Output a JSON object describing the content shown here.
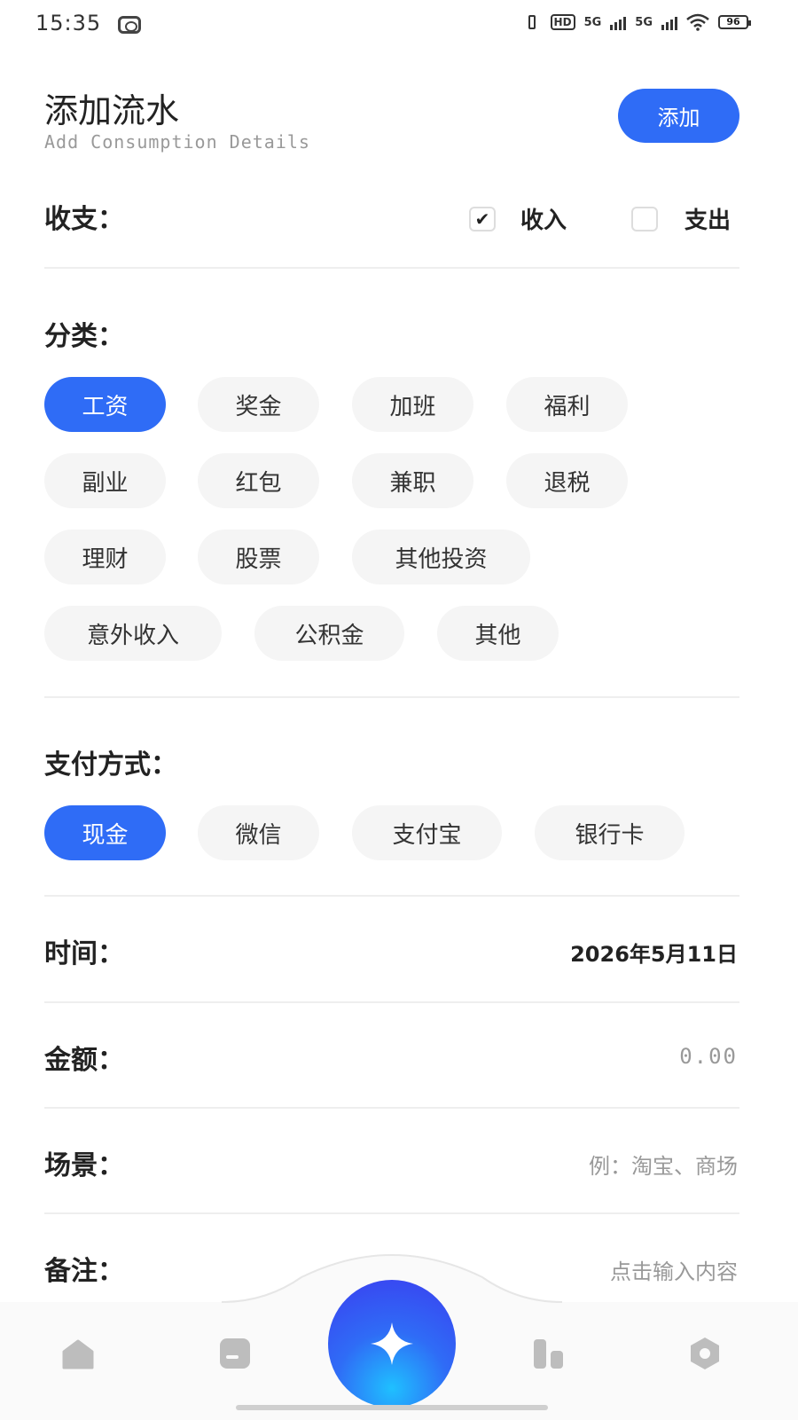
{
  "status_bar": {
    "time": "15:35",
    "battery": "96",
    "net1": "5G",
    "net2": "5G",
    "hd": "HD"
  },
  "header": {
    "title": "添加流水",
    "subtitle": "Add Consumption Details",
    "add_button": "添加"
  },
  "type_section": {
    "label": "收支：",
    "options": [
      {
        "label": "收入",
        "checked": true
      },
      {
        "label": "支出",
        "checked": false
      }
    ]
  },
  "category_section": {
    "label": "分类：",
    "items": [
      "工资",
      "奖金",
      "加班",
      "福利",
      "副业",
      "红包",
      "兼职",
      "退税",
      "理财",
      "股票",
      "其他投资",
      "意外收入",
      "公积金",
      "其他"
    ],
    "selected": "工资"
  },
  "payment_section": {
    "label": "支付方式：",
    "items": [
      "现金",
      "微信",
      "支付宝",
      "银行卡"
    ],
    "selected": "现金"
  },
  "time_row": {
    "label": "时间：",
    "value": "2026年5月11日"
  },
  "amount_row": {
    "label": "金额：",
    "placeholder": "0.00"
  },
  "scene_row": {
    "label": "场景：",
    "placeholder": "例：淘宝、商场"
  },
  "note_row": {
    "label": "备注：",
    "placeholder": "点击输入内容"
  },
  "bottom_nav": {
    "items": [
      "home-icon",
      "bill-icon",
      "add-icon",
      "stats-icon",
      "settings-icon"
    ],
    "accent": "#2f6cf6"
  }
}
